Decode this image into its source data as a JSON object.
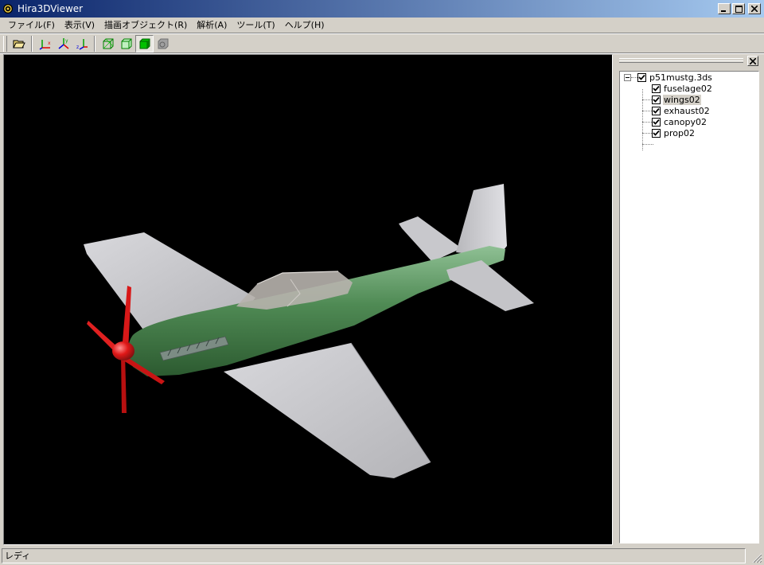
{
  "window": {
    "title": "Hira3DViewer"
  },
  "menu": {
    "items": [
      {
        "label": "ファイル(F)"
      },
      {
        "label": "表示(V)"
      },
      {
        "label": "描画オブジェクト(R)"
      },
      {
        "label": "解析(A)"
      },
      {
        "label": "ツール(T)"
      },
      {
        "label": "ヘルプ(H)"
      }
    ]
  },
  "toolbar": {
    "buttons": [
      {
        "icon": "open-folder-icon"
      },
      {
        "icon": "axis-x-icon"
      },
      {
        "icon": "axis-y-icon"
      },
      {
        "icon": "axis-z-icon"
      },
      {
        "icon": "wireframe-icon"
      },
      {
        "icon": "hidden-line-icon"
      },
      {
        "icon": "solid-shading-icon",
        "active": true
      },
      {
        "icon": "texture-icon",
        "disabled": true
      }
    ]
  },
  "tree": {
    "root": {
      "label": "p51mustg.3ds",
      "checked": true,
      "expanded": true
    },
    "children": [
      {
        "label": "fuselage02",
        "checked": true,
        "selected": false
      },
      {
        "label": "wings02",
        "checked": true,
        "selected": true
      },
      {
        "label": "exhaust02",
        "checked": true,
        "selected": false
      },
      {
        "label": "canopy02",
        "checked": true,
        "selected": false
      },
      {
        "label": "prop02",
        "checked": true,
        "selected": false
      }
    ]
  },
  "viewport": {
    "background": "#000000",
    "model": "p51mustg.3ds",
    "colors": {
      "fuselage": "#4f8a54",
      "wings": "#c8c8cc",
      "propeller": "#e01818"
    }
  },
  "status": {
    "text": "レディ"
  }
}
